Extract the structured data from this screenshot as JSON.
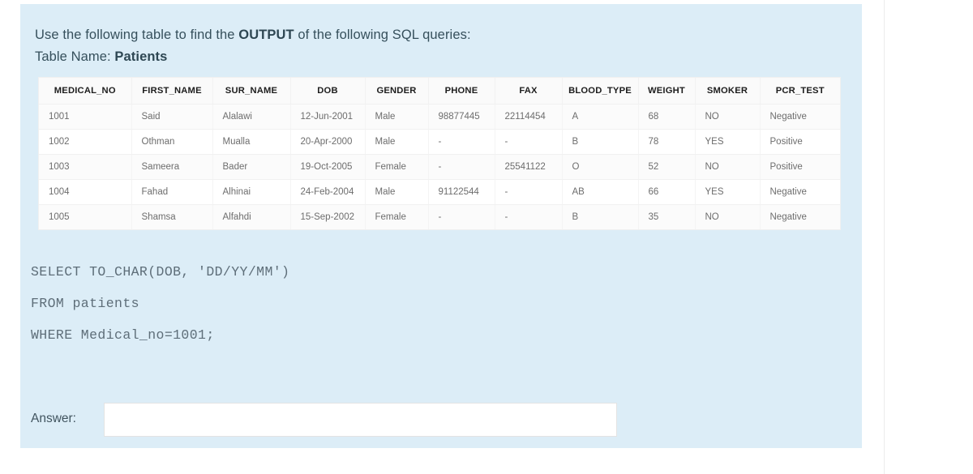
{
  "prompt": {
    "line1_pre": "Use the following table to find the ",
    "line1_bold": "OUTPUT",
    "line1_post": " of the following SQL queries:",
    "line2_pre": "Table Name: ",
    "line2_bold": "Patients"
  },
  "table": {
    "name": "Patients",
    "columns": [
      "MEDICAL_NO",
      "FIRST_NAME",
      "SUR_NAME",
      "DOB",
      "GENDER",
      "PHONE",
      "FAX",
      "BLOOD_TYPE",
      "WEIGHT",
      "SMOKER",
      "PCR_TEST"
    ],
    "rows": [
      {
        "medical_no": "1001",
        "first_name": "Said",
        "sur_name": "Alalawi",
        "dob": "12-Jun-2001",
        "gender": "Male",
        "phone": "98877445",
        "fax": "22114454",
        "blood_type": "A",
        "weight": "68",
        "smoker": "NO",
        "pcr_test": "Negative"
      },
      {
        "medical_no": "1002",
        "first_name": "Othman",
        "sur_name": "Mualla",
        "dob": "20-Apr-2000",
        "gender": "Male",
        "phone": "-",
        "fax": "-",
        "blood_type": "B",
        "weight": "78",
        "smoker": "YES",
        "pcr_test": "Positive"
      },
      {
        "medical_no": "1003",
        "first_name": "Sameera",
        "sur_name": "Bader",
        "dob": "19-Oct-2005",
        "gender": "Female",
        "phone": "-",
        "fax": "25541122",
        "blood_type": "O",
        "weight": "52",
        "smoker": "NO",
        "pcr_test": "Positive"
      },
      {
        "medical_no": "1004",
        "first_name": "Fahad",
        "sur_name": "Alhinai",
        "dob": "24-Feb-2004",
        "gender": "Male",
        "phone": "91122544",
        "fax": "-",
        "blood_type": "AB",
        "weight": "66",
        "smoker": "YES",
        "pcr_test": "Negative"
      },
      {
        "medical_no": "1005",
        "first_name": "Shamsa",
        "sur_name": "Alfahdi",
        "dob": "15-Sep-2002",
        "gender": "Female",
        "phone": "-",
        "fax": "-",
        "blood_type": "B",
        "weight": "35",
        "smoker": "NO",
        "pcr_test": "Negative"
      }
    ]
  },
  "sql": {
    "line1": "SELECT TO_CHAR(DOB, 'DD/YY/MM')",
    "line2": "FROM patients",
    "line3": "WHERE Medical_no=1001;"
  },
  "answer": {
    "label": "Answer:",
    "value": "",
    "placeholder": ""
  },
  "colors": {
    "card_background": "#dcedf7",
    "table_header_background": "#fafafa",
    "text": "#36505c",
    "sql_text": "#5e6e79"
  }
}
